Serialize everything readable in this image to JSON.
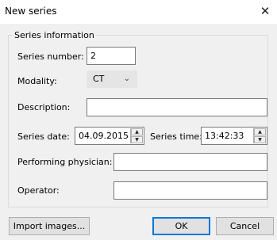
{
  "window": {
    "title": "New series",
    "close_glyph": "✕"
  },
  "group": {
    "legend": "Series information"
  },
  "fields": {
    "series_number": {
      "label": "Series number:",
      "value": "2"
    },
    "modality": {
      "label": "Modality:",
      "value": "CT",
      "icon": "chevron-down-icon"
    },
    "description": {
      "label": "Description:",
      "value": ""
    },
    "series_date": {
      "label": "Series date:",
      "value": "04.09.2015"
    },
    "series_time": {
      "label": "Series time:",
      "value": "13:42:33"
    },
    "performing_physician": {
      "label": "Performing physician:",
      "value": ""
    },
    "operator": {
      "label": "Operator:",
      "value": ""
    }
  },
  "buttons": {
    "import": "Import images...",
    "ok": "OK",
    "cancel": "Cancel"
  }
}
